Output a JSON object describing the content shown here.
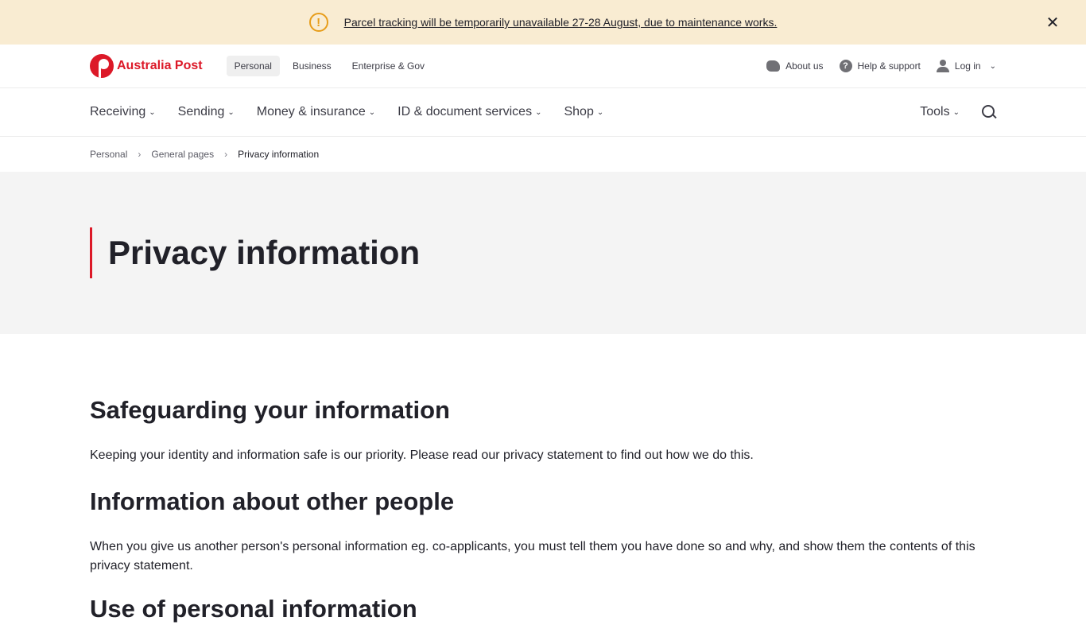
{
  "banner": {
    "message": "Parcel tracking will be temporarily unavailable 27-28 August, due to maintenance works.",
    "close": "✕"
  },
  "header": {
    "logo_text": "Australia Post",
    "segments": [
      "Personal",
      "Business",
      "Enterprise & Gov"
    ],
    "about": "About us",
    "help": "Help & support",
    "login": "Log in"
  },
  "nav": {
    "items": [
      "Receiving",
      "Sending",
      "Money & insurance",
      "ID & document services",
      "Shop"
    ],
    "tools": "Tools"
  },
  "breadcrumb": [
    "Personal",
    "General pages",
    "Privacy information"
  ],
  "hero": {
    "title": "Privacy information"
  },
  "sections": [
    {
      "heading": "Safeguarding your information",
      "body": "Keeping your identity and information safe is our priority. Please read our privacy statement to find out how we do this."
    },
    {
      "heading": "Information about other people",
      "body": "When you give us another person's personal information eg. co-applicants, you must tell them you have done so and why, and show them the contents of this privacy statement."
    },
    {
      "heading": "Use of personal information"
    }
  ],
  "colors": {
    "brand": "#dc1928",
    "banner_bg": "#f9ecd2",
    "warning": "#e79d1a",
    "hero_bg": "#f4f4f4"
  }
}
